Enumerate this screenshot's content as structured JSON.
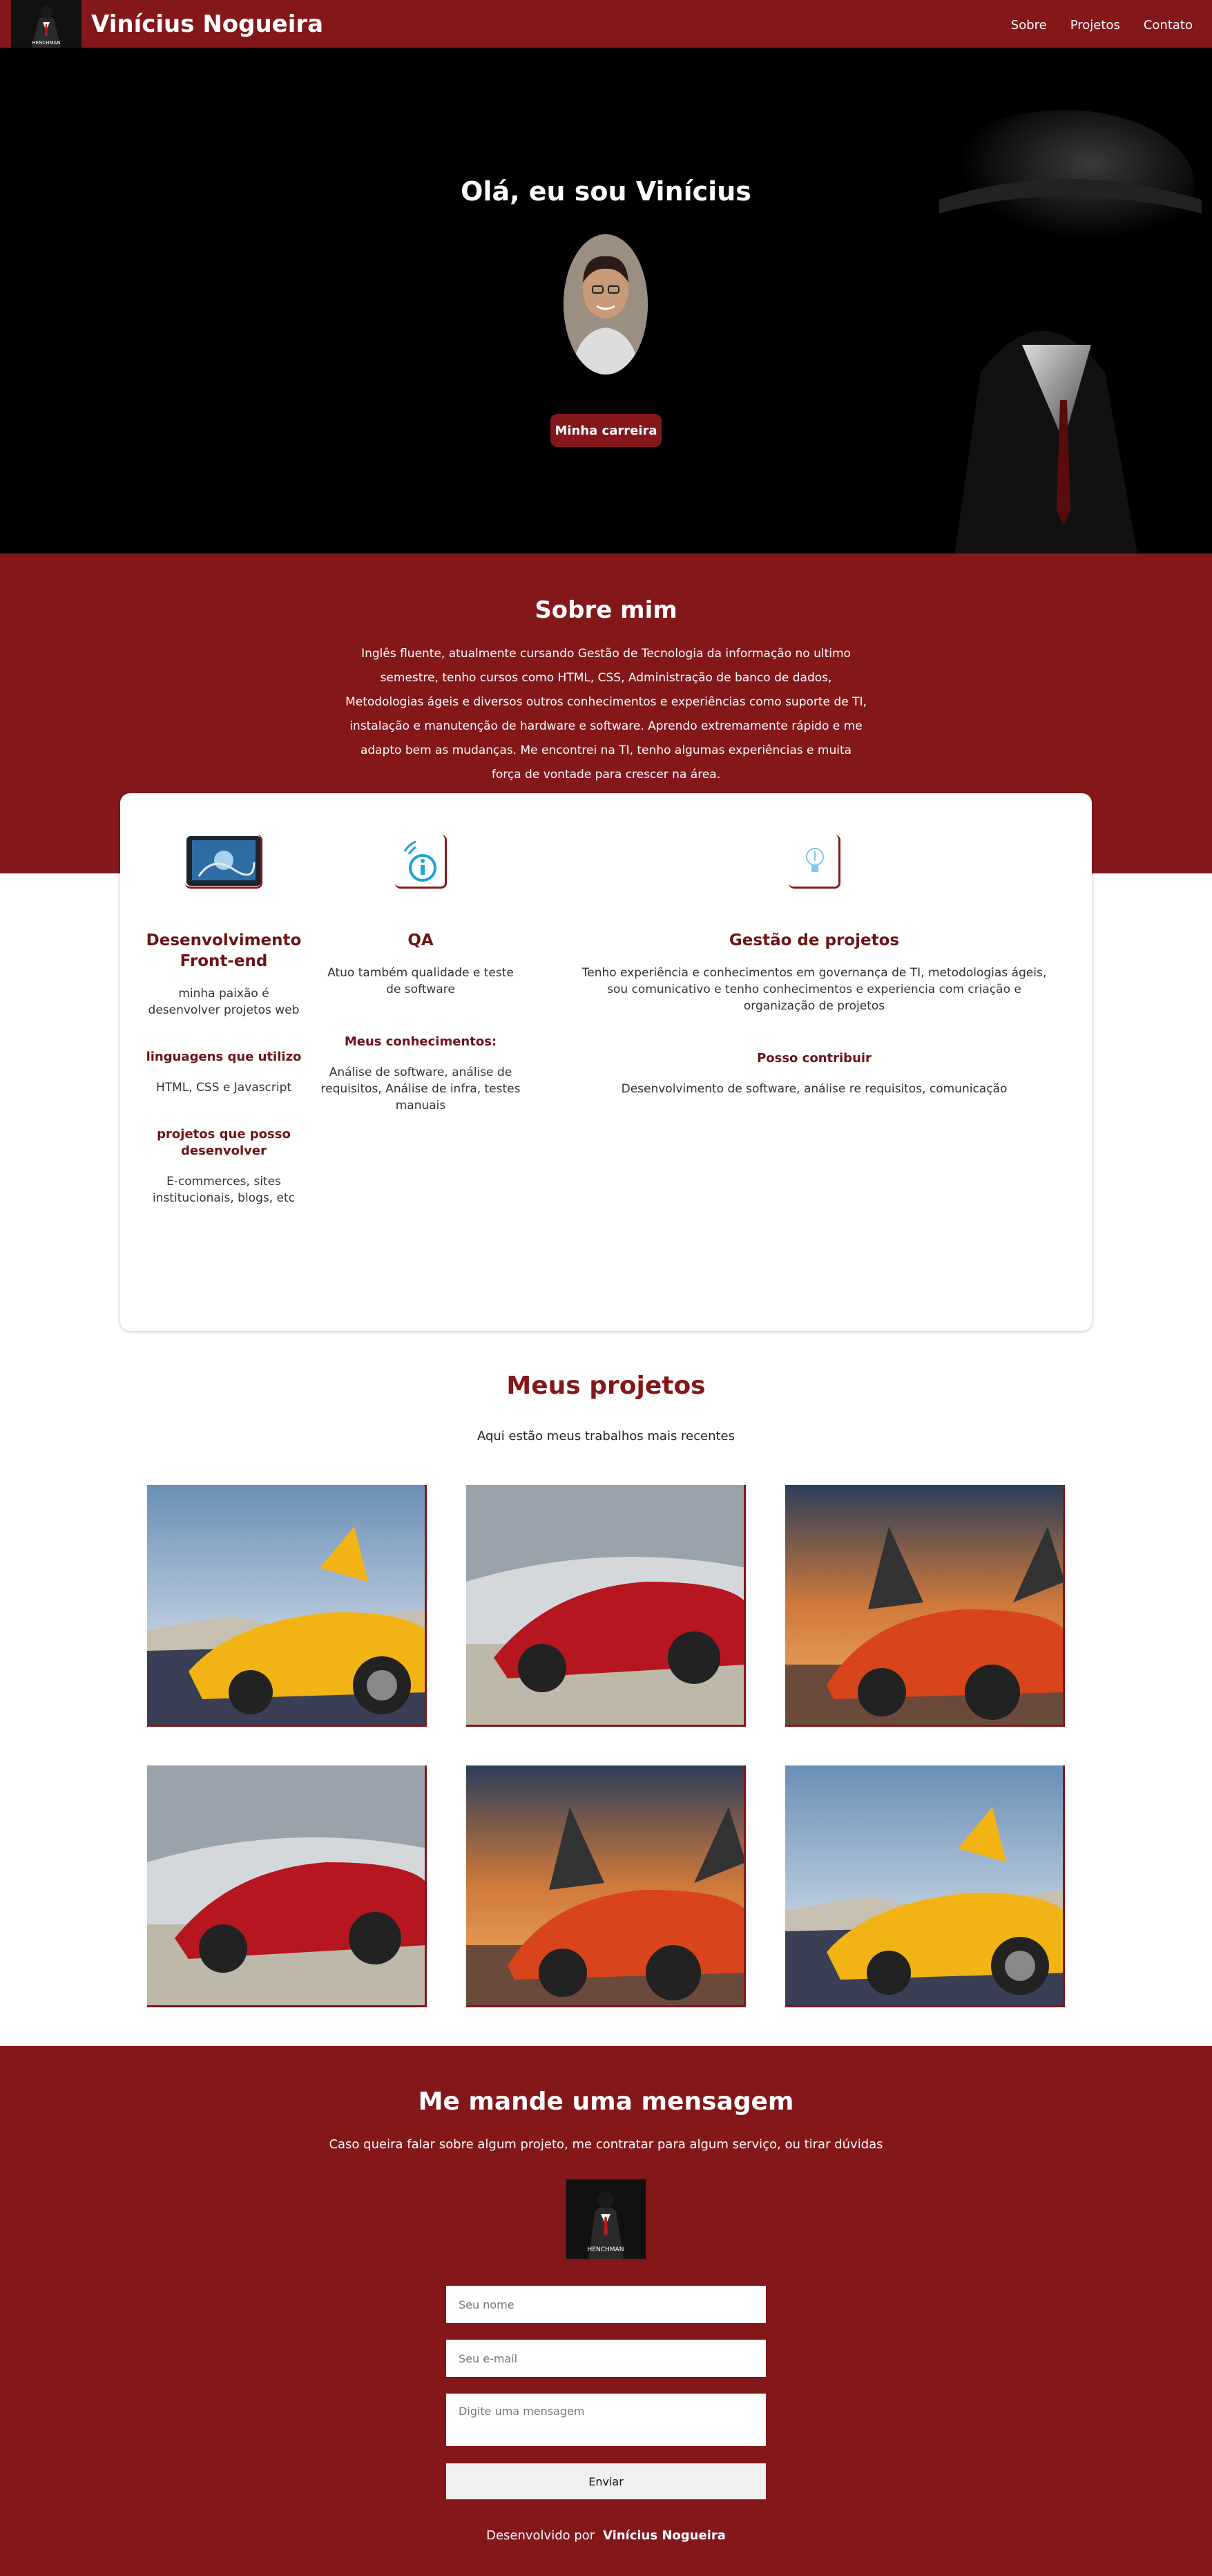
{
  "nav": {
    "brand": "Vinícius Nogueira",
    "logo_text": "HENCHMAN",
    "links": [
      "Sobre",
      "Projetos",
      "Contato"
    ]
  },
  "hero": {
    "title": "Olá, eu sou Vinícius",
    "button": "Minha carreira"
  },
  "about": {
    "title": "Sobre mim",
    "text": "Inglês fluente, atualmente cursando Gestão de Tecnologia da informação no ultimo semestre, tenho cursos como HTML, CSS, Administração de banco de dados, Metodologias ágeis e diversos outros conhecimentos e experiências como suporte de TI, instalação e manutenção de hardware e software. Aprendo extremamente rápido e me adapto bem as mudanças. Me encontrei na TI, tenho algumas experiências e muita força de vontade para crescer na área."
  },
  "skills": {
    "frontend": {
      "title": "Desenvolvimento Front-end",
      "text": "minha paixão é desenvolver projetos web",
      "sub1": "linguagens que utilizo",
      "sub1_text": "HTML, CSS e Javascript",
      "sub2": "projetos que posso desenvolver",
      "sub2_text": "E-commerces, sites institucionais, blogs, etc"
    },
    "qa": {
      "title": "QA",
      "text": "Atuo também qualidade e teste de software",
      "sub1": "Meus conhecimentos:",
      "sub1_text": "Análise de software, análise de requisitos, Análise de infra, testes manuais"
    },
    "gestao": {
      "title": "Gestão de projetos",
      "text": "Tenho experiência e conhecimentos em governança de TI, metodologias ágeis, sou comunicativo e tenho conhecimentos e experiencia com criação e organização de projetos",
      "sub1": "Posso contribuir",
      "sub1_text": "Desenvolvimento de software, análise re requisitos, comunicação"
    }
  },
  "projects": {
    "title": "Meus projetos",
    "subtitle": "Aqui estão meus trabalhos mais recentes"
  },
  "contact": {
    "title": "Me mande uma mensagem",
    "subtitle": "Caso queira falar sobre algum projeto, me contratar para algum serviço, ou tirar dúvidas",
    "logo_text": "HENCHMAN",
    "name_placeholder": "Seu nome",
    "email_placeholder": "Seu e-mail",
    "message_placeholder": "Digite uma mensagem",
    "send": "Enviar",
    "footer_prefix": "Desenvolvido por",
    "footer_name": "Vinícius Nogueira"
  }
}
